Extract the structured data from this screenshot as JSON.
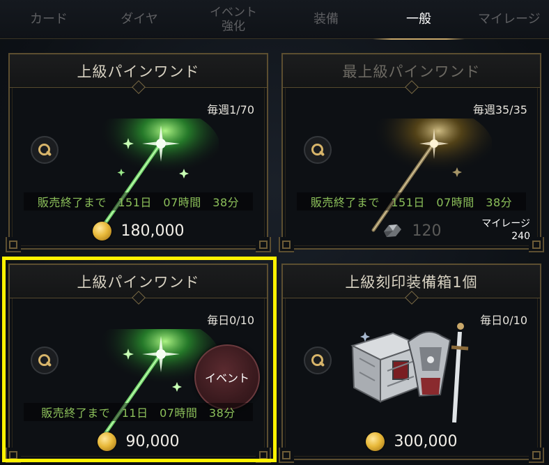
{
  "tabs": [
    {
      "label": "カード",
      "active": false
    },
    {
      "label": "ダイヤ",
      "active": false
    },
    {
      "label": "イベント\n強化",
      "active": false
    },
    {
      "label": "装備",
      "active": false
    },
    {
      "label": "一般",
      "active": true
    },
    {
      "label": "マイレージ",
      "active": false
    }
  ],
  "cards": [
    {
      "title": "上級パインワンド",
      "limit": "毎週1/70",
      "timer": "販売終了まで　151日　07時間　38分",
      "price": "180,000",
      "currency": "coin-icon",
      "available": true
    },
    {
      "title": "最上級パインワンド",
      "limit": "毎週35/35",
      "timer": "販売終了まで　151日　07時間　38分",
      "price": "120",
      "currency": "crystal-icon",
      "mileage_label": "マイレージ",
      "mileage_value": "240",
      "available": false
    },
    {
      "title": "上級パインワンド",
      "limit": "毎日0/10",
      "timer": "販売終了まで　11日　07時間　38分",
      "price": "90,000",
      "currency": "coin-icon",
      "badge": "イベント",
      "highlighted": true,
      "available": true
    },
    {
      "title": "上級刻印装備箱1個",
      "limit": "毎日0/10",
      "price": "300,000",
      "currency": "coin-icon",
      "available": true
    }
  ],
  "colors": {
    "accent_gold": "#c9a86a",
    "timer_green": "#8cc05a",
    "highlight_yellow": "#fff200",
    "frame_brown": "#5c4e30"
  }
}
